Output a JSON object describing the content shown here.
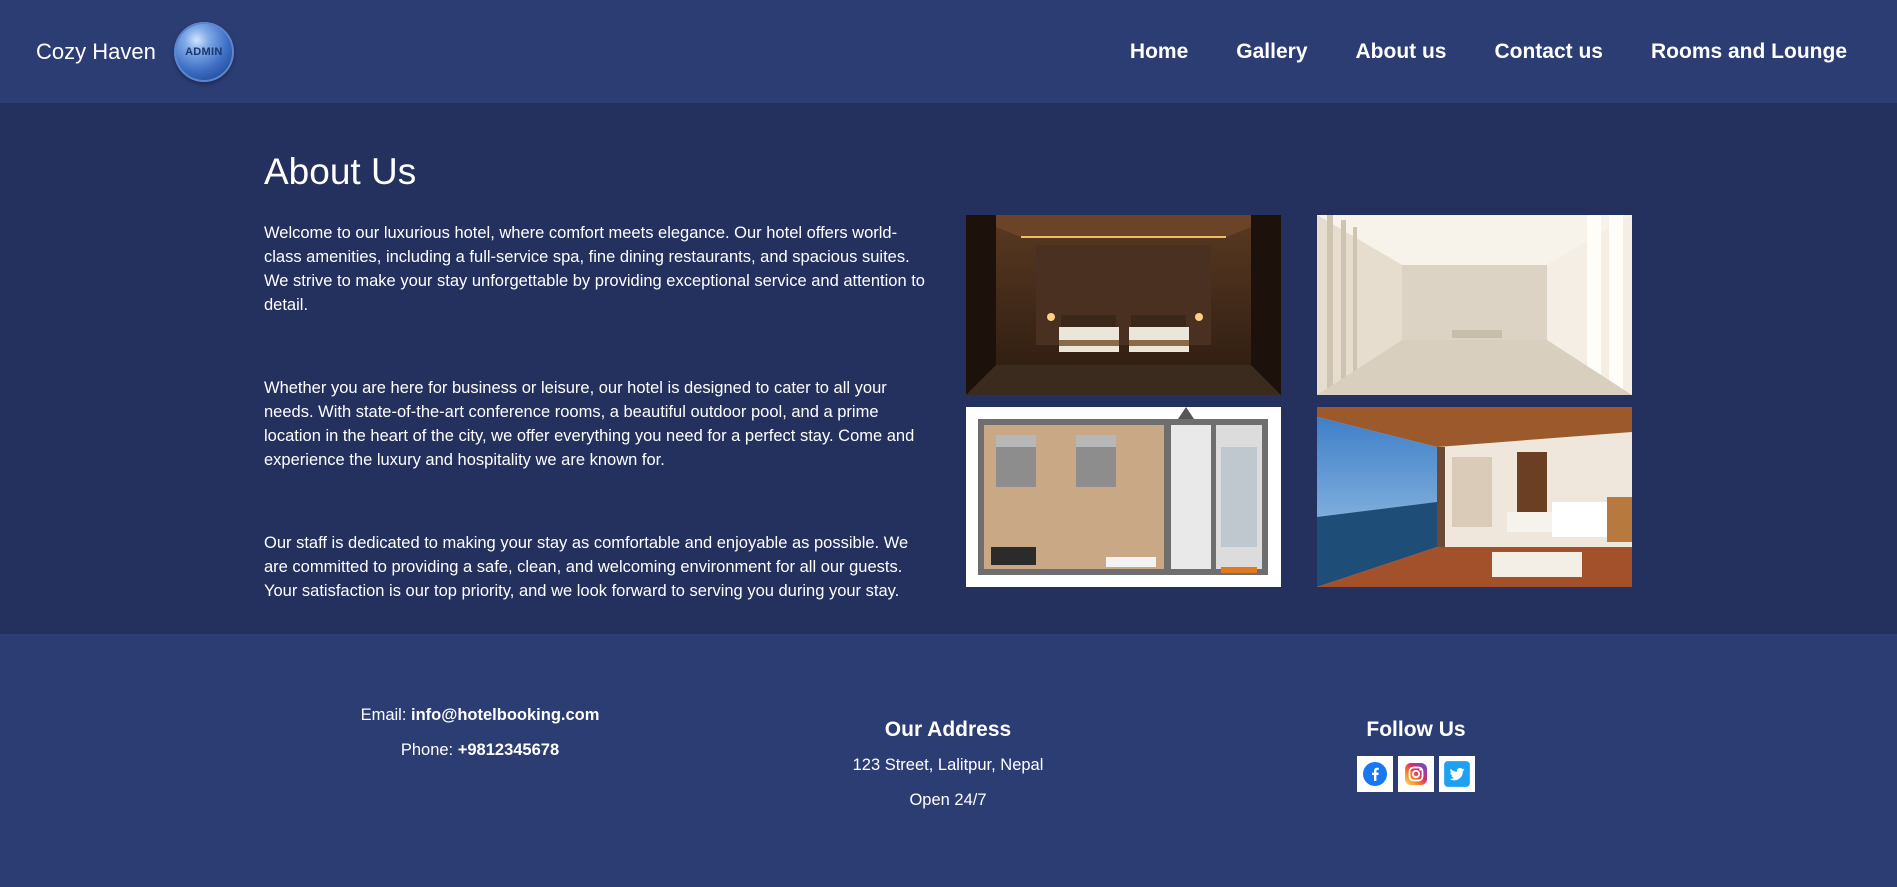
{
  "header": {
    "brand": "Cozy Haven",
    "logo_text": "ADMIN",
    "nav": [
      {
        "label": "Home"
      },
      {
        "label": "Gallery"
      },
      {
        "label": "About us"
      },
      {
        "label": "Contact us"
      },
      {
        "label": "Rooms and Lounge"
      }
    ]
  },
  "about": {
    "title": "About Us",
    "paragraphs": [
      "Welcome to our luxurious hotel, where comfort meets elegance. Our hotel offers world-class amenities, including a full-service spa, fine dining restaurants, and spacious suites. We strive to make your stay unforgettable by providing exceptional service and attention to detail.",
      "Whether you are here for business or leisure, our hotel is designed to cater to all your needs. With state-of-the-art conference rooms, a beautiful outdoor pool, and a prime location in the heart of the city, we offer everything you need for a perfect stay. Come and experience the luxury and hospitality we are known for.",
      "Our staff is dedicated to making your stay as comfortable and enjoyable as possible. We are committed to providing a safe, clean, and welcoming environment for all our guests. Your satisfaction is our top priority, and we look forward to serving you during your stay."
    ]
  },
  "footer": {
    "email_label": "Email: ",
    "email": "info@hotelbooking.com",
    "phone_label": "Phone: ",
    "phone": "+9812345678",
    "address_title": "Our Address",
    "address": "123 Street, Lalitpur, Nepal",
    "hours": "Open 24/7",
    "follow_title": "Follow Us",
    "socials": [
      "facebook-icon",
      "instagram-icon",
      "twitter-icon"
    ]
  },
  "colors": {
    "header_bg": "#2c3d73",
    "main_bg": "#24315f",
    "footer_bg": "#2c3d73",
    "text": "#ffffff"
  }
}
